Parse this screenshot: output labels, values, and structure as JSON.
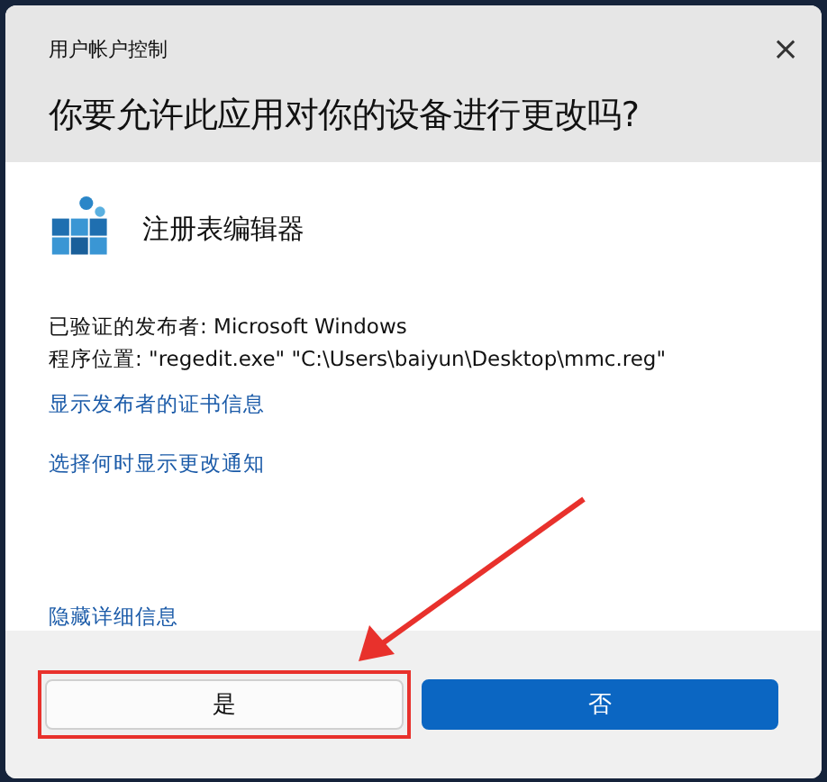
{
  "window": {
    "title": "用户帐户控制",
    "close": "×"
  },
  "question": "你要允许此应用对你的设备进行更改吗?",
  "app": {
    "name": "注册表编辑器"
  },
  "details": [
    {
      "label": "已验证的发布者:",
      "value": "Microsoft Windows"
    },
    {
      "label": "程序位置:",
      "value": "\"regedit.exe\" \"C:\\Users\\baiyun\\Desktop\\mmc.reg\""
    }
  ],
  "links": [
    {
      "text": "显示发布者的证书信息",
      "kind": "near"
    },
    {
      "text": "选择何时显示更改通知",
      "kind": "near"
    },
    {
      "text": "隐藏详细信息",
      "kind": "far"
    }
  ],
  "buttons": [
    {
      "label": "是",
      "kind": "secondary",
      "highlighted": true
    },
    {
      "label": "否",
      "kind": "primary",
      "highlighted": false
    }
  ]
}
